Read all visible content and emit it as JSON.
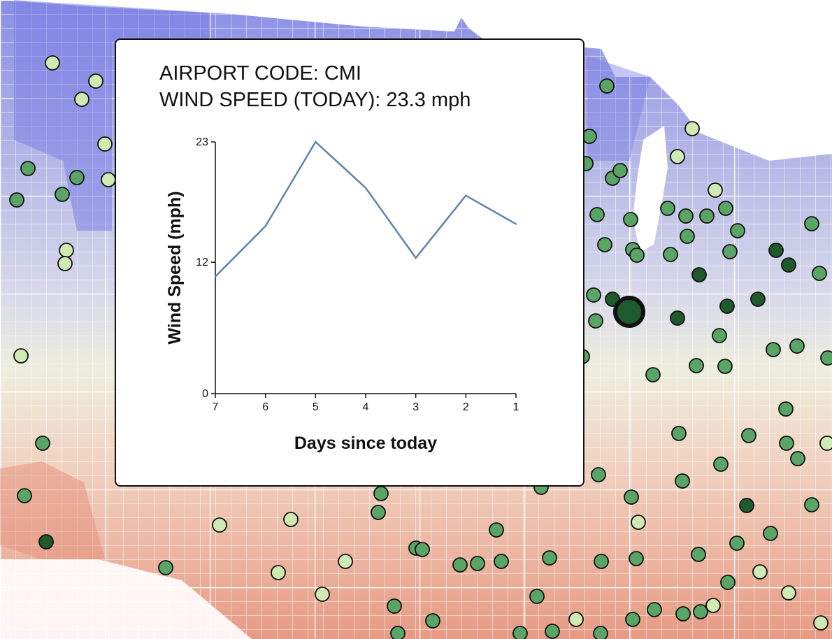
{
  "tooltip": {
    "airport_label": "AIRPORT CODE:",
    "airport_code": "CMI",
    "wind_label": "WIND SPEED (TODAY):",
    "wind_value": "23.3 mph"
  },
  "chart_data": {
    "type": "line",
    "x": [
      7,
      6,
      5,
      4,
      3,
      2,
      1
    ],
    "x_tick_labels": [
      "7",
      "6",
      "5",
      "4",
      "3",
      "2",
      "1"
    ],
    "values": [
      10.7,
      15.3,
      23.0,
      18.8,
      12.4,
      18.1,
      15.5
    ],
    "y_tick_labels": [
      "0",
      "12",
      "23"
    ],
    "y_ticks": [
      0,
      12,
      23
    ],
    "ylim": [
      0,
      23
    ],
    "xlim": [
      7,
      1
    ],
    "xlabel": "Days since today",
    "ylabel": "Wind Speed (mph)",
    "line_color": "#5b84ad",
    "grid": false
  },
  "map": {
    "colors": {
      "cold": "#7b7fe4",
      "cool": "#c9cce8",
      "neutral": "#f0efe0",
      "warm": "#ebbca6",
      "hot": "#e3907a",
      "marker_dark": "#1f5a2c",
      "marker_mid": "#5aa566",
      "marker_light": "#cfeab2",
      "county_border": "#ffffff"
    },
    "selected_airport": "CMI"
  }
}
